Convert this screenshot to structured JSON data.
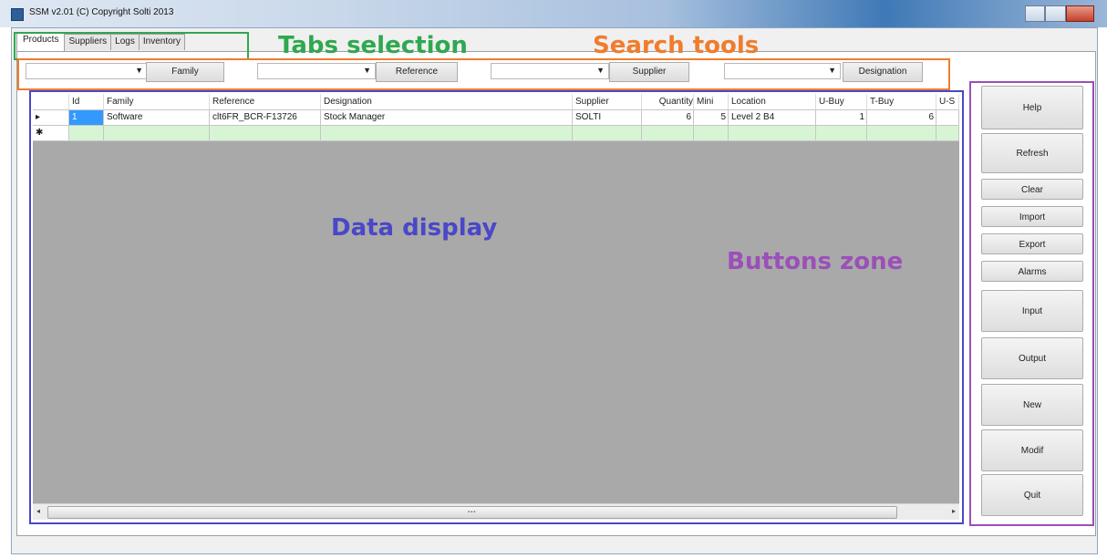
{
  "window": {
    "title": "SSM v2.01 (C) Copyright Solti 2013"
  },
  "tabs": [
    "Products",
    "Suppliers",
    "Logs",
    "Inventory"
  ],
  "search": {
    "family_label": "Family",
    "reference_label": "Reference",
    "supplier_label": "Supplier",
    "designation_label": "Designation"
  },
  "grid": {
    "columns": [
      "Id",
      "Family",
      "Reference",
      "Designation",
      "Supplier",
      "Quantity",
      "Mini",
      "Location",
      "U-Buy",
      "T-Buy",
      "U-S"
    ],
    "rows": [
      {
        "row_marker": "▸",
        "id": "1",
        "family": "Software",
        "reference": "clt6FR_BCR-F13726",
        "designation": "Stock Manager",
        "supplier": "SOLTI",
        "quantity": "6",
        "mini": "5",
        "location": "Level 2 B4",
        "u_buy": "1",
        "t_buy": "6",
        "u_s": ""
      }
    ],
    "new_row_marker": "✱"
  },
  "buttons": {
    "help": "Help",
    "refresh": "Refresh",
    "clear": "Clear",
    "import": "Import",
    "export": "Export",
    "alarms": "Alarms",
    "input": "Input",
    "output": "Output",
    "new": "New",
    "modif": "Modif",
    "quit": "Quit"
  },
  "annotations": {
    "tabs_selection": "Tabs selection",
    "search_tools": "Search tools",
    "data_display": "Data display",
    "buttons_zone": "Buttons zone"
  },
  "colors": {
    "tabs_selection": "#2fa84f",
    "search_tools": "#f07c2c",
    "data_display": "#4a47c8",
    "buttons_zone": "#9b4fb8"
  }
}
